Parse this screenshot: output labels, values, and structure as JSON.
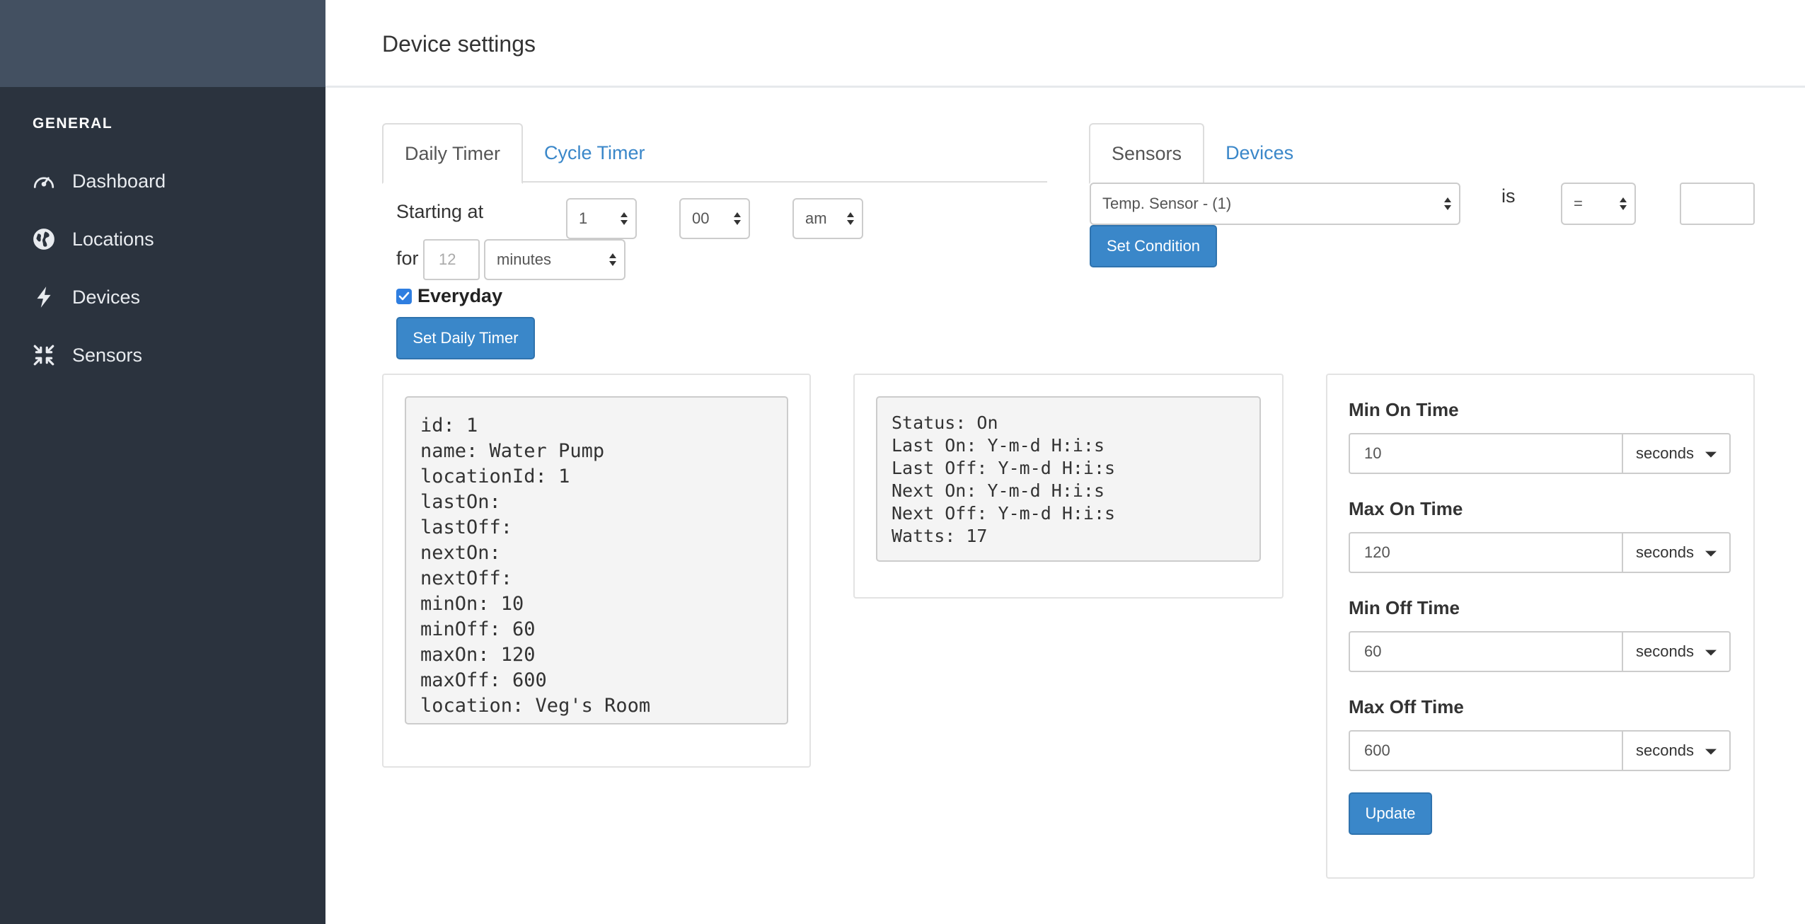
{
  "sidebar": {
    "section": "GENERAL",
    "items": [
      {
        "label": "Dashboard",
        "icon": "dashboard-icon"
      },
      {
        "label": "Locations",
        "icon": "globe-icon"
      },
      {
        "label": "Devices",
        "icon": "bolt-icon"
      },
      {
        "label": "Sensors",
        "icon": "compress-icon"
      }
    ]
  },
  "header": {
    "title": "Device settings"
  },
  "timer": {
    "tabs": [
      "Daily Timer",
      "Cycle Timer"
    ],
    "starting_label": "Starting at",
    "hour": "1",
    "minute": "00",
    "ampm": "am",
    "for_label": "for",
    "duration_placeholder": "12",
    "unit": "minutes",
    "everyday_label": "Everyday",
    "everyday_checked": true,
    "button": "Set Daily Timer"
  },
  "sensors": {
    "tabs": [
      "Sensors",
      "Devices"
    ],
    "sensor_select": "Temp. Sensor - (1)",
    "is_label": "is",
    "operator": "=",
    "value": "",
    "button": "Set Condition"
  },
  "device_info": {
    "lines": [
      "id: 1",
      "name: Water Pump",
      "locationId: 1",
      "lastOn:",
      "lastOff:",
      "nextOn:",
      "nextOff:",
      "minOn: 10",
      "minOff: 60",
      "maxOn: 120",
      "maxOff: 600",
      "location: Veg's Room"
    ]
  },
  "status_info": {
    "lines": [
      "Status: On",
      "Last On: Y-m-d H:i:s",
      "Last Off: Y-m-d H:i:s",
      "Next On: Y-m-d H:i:s",
      "Next Off: Y-m-d H:i:s",
      "Watts: 17"
    ]
  },
  "settings": {
    "fields": [
      {
        "label": "Min On Time",
        "value": "10",
        "unit": "seconds"
      },
      {
        "label": "Max On Time",
        "value": "120",
        "unit": "seconds"
      },
      {
        "label": "Min Off Time",
        "value": "60",
        "unit": "seconds"
      },
      {
        "label": "Max Off Time",
        "value": "600",
        "unit": "seconds"
      }
    ],
    "button": "Update"
  },
  "colors": {
    "sidebar_bg": "#2b333e",
    "sidebar_brand": "#435061",
    "accent": "#3a87c9"
  }
}
